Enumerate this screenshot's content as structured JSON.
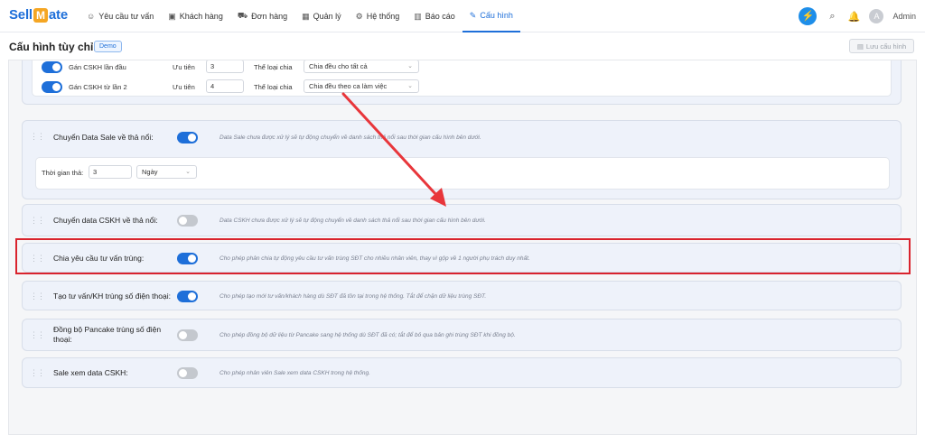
{
  "brand": {
    "part1": "Sell",
    "m": "M",
    "part2": "ate"
  },
  "nav": {
    "items": [
      {
        "icon": "☺",
        "label": "Yêu cầu tư vấn"
      },
      {
        "icon": "▣",
        "label": "Khách hàng"
      },
      {
        "icon": "⛟",
        "label": "Đơn hàng"
      },
      {
        "icon": "▦",
        "label": "Quản lý"
      },
      {
        "icon": "⚙",
        "label": "Hệ thống"
      },
      {
        "icon": "▥",
        "label": "Báo cáo"
      },
      {
        "icon": "✎",
        "label": "Cấu hình"
      }
    ],
    "user": {
      "avatar": "A",
      "name": "Admin"
    },
    "icons": {
      "bolt": "⚡",
      "search": "⌕",
      "bell": "🔔"
    }
  },
  "header": {
    "title": "Cấu hình tùy chỉnh",
    "badge": "Demo",
    "save_label": "Lưu cấu hình",
    "save_icon": "▤"
  },
  "assign_panel": {
    "rows": [
      {
        "label": "Gán CSKH lần đầu",
        "priority_label": "Ưu tiên",
        "priority": "3",
        "type_label": "Thể loại chia",
        "type": "Chia đều cho tất cả"
      },
      {
        "label": "Gán CSKH từ lần 2",
        "priority_label": "Ưu tiên",
        "priority": "4",
        "type_label": "Thể loại chia",
        "type": "Chia đều theo ca làm việc"
      }
    ]
  },
  "settings": [
    {
      "label": "Chuyển Data Sale về thả nổi:",
      "on": true,
      "desc": "Data Sale chưa được xử lý sẽ tự động chuyển về danh sách thả nổi sau thời gian cấu hình bên dưới."
    },
    {
      "label": "Chuyển data CSKH về thả nổi:",
      "on": false,
      "desc": "Data CSKH chưa được xử lý sẽ tự động chuyển về danh sách thả nổi sau thời gian cấu hình bên dưới."
    },
    {
      "label": "Chia yêu cầu tư vấn trùng:",
      "on": true,
      "desc": "Cho phép phân chia tự động yêu cầu tư vấn trùng SĐT cho nhiều nhân viên, thay vì gộp về 1 người phụ trách duy nhất."
    },
    {
      "label": "Tạo tư vấn/KH trùng số điện thoại:",
      "on": true,
      "desc": "Cho phép tạo mới tư vấn/khách hàng dù SĐT đã tồn tại trong hệ thống. Tắt để chặn dữ liệu trùng SĐT."
    },
    {
      "label": "Đồng bộ Pancake trùng số điện thoại:",
      "on": false,
      "desc": "Cho phép đồng bộ dữ liệu từ Pancake sang hệ thống dù SĐT đã có; tắt để bỏ qua bản ghi trùng SĐT khi đồng bộ."
    },
    {
      "label": "Sale xem data CSKH:",
      "on": false,
      "desc": "Cho phép nhân viên Sale xem data CSKH trong hệ thống."
    }
  ],
  "float_time": {
    "label": "Thời gian thả:",
    "value": "3",
    "unit": "Ngày"
  },
  "drag_glyph": "⋮⋮",
  "chev": "⌄"
}
